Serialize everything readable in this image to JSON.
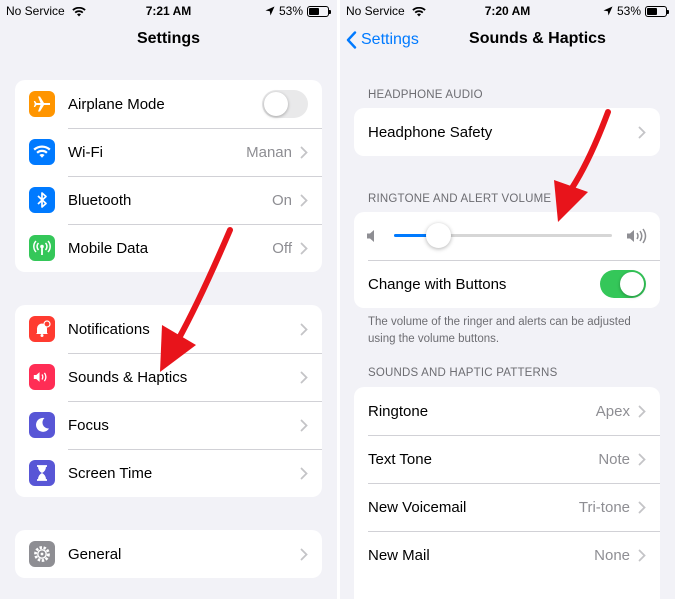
{
  "left": {
    "status": {
      "carrier": "No Service",
      "time": "7:21 AM",
      "battery": "53%",
      "battery_level": 0.53
    },
    "title": "Settings",
    "group1": [
      {
        "label": "Airplane Mode",
        "icon": "airplane-icon",
        "color": "#ff9500",
        "toggle": "off"
      },
      {
        "label": "Wi-Fi",
        "icon": "wifi-icon",
        "color": "#007aff",
        "value": "Manan"
      },
      {
        "label": "Bluetooth",
        "icon": "bluetooth-icon",
        "color": "#007aff",
        "value": "On"
      },
      {
        "label": "Mobile Data",
        "icon": "antenna-icon",
        "color": "#34c759",
        "value": "Off"
      }
    ],
    "group2": [
      {
        "label": "Notifications",
        "icon": "bell-icon",
        "color": "#ff3b30"
      },
      {
        "label": "Sounds & Haptics",
        "icon": "speaker-icon",
        "color": "#ff2d55"
      },
      {
        "label": "Focus",
        "icon": "moon-icon",
        "color": "#5856d6"
      },
      {
        "label": "Screen Time",
        "icon": "hourglass-icon",
        "color": "#5856d6"
      }
    ],
    "group3": [
      {
        "label": "General",
        "icon": "gear-icon",
        "color": "#8e8e93"
      }
    ]
  },
  "right": {
    "status": {
      "carrier": "No Service",
      "time": "7:20 AM",
      "battery": "53%",
      "battery_level": 0.53
    },
    "back_label": "Settings",
    "title": "Sounds & Haptics",
    "headphone_header": "HEADPHONE AUDIO",
    "headphone_safety": "Headphone Safety",
    "ringtone_header": "RINGTONE AND ALERT VOLUME",
    "volume_level": 0.2,
    "change_with_buttons": "Change with Buttons",
    "change_with_buttons_on": true,
    "footnote": "The volume of the ringer and alerts can be adjusted using the volume buttons.",
    "patterns_header": "SOUNDS AND HAPTIC PATTERNS",
    "patterns": [
      {
        "label": "Ringtone",
        "value": "Apex"
      },
      {
        "label": "Text Tone",
        "value": "Note"
      },
      {
        "label": "New Voicemail",
        "value": "Tri-tone"
      },
      {
        "label": "New Mail",
        "value": "None"
      }
    ]
  },
  "colors": {
    "accent": "#007aff",
    "toggle_on": "#34c759",
    "arrow": "#e8141b"
  }
}
